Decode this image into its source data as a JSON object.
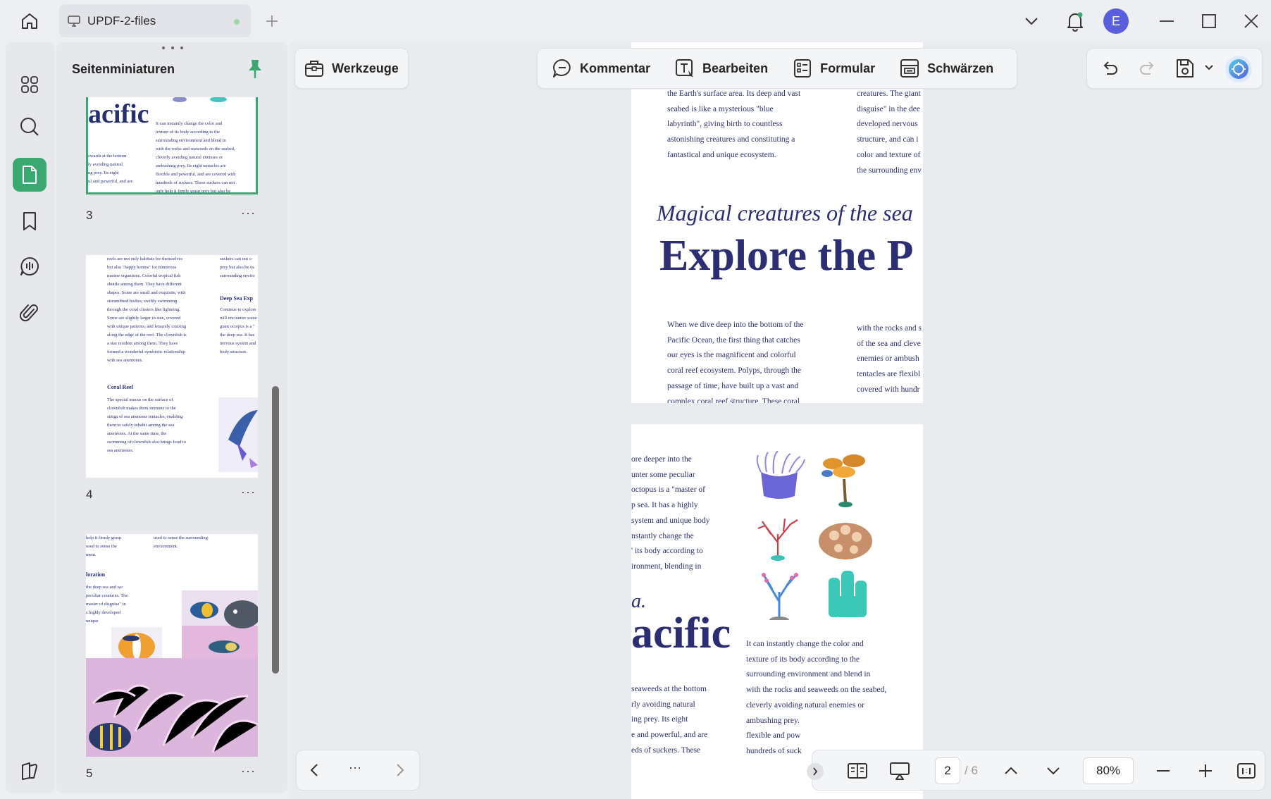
{
  "app": {
    "tab_title": "UPDF-2-files",
    "avatar_letter": "E"
  },
  "sidebar": {
    "panel_title": "Seitenminiaturen",
    "thumbnails": [
      {
        "number": "3",
        "more": "···"
      },
      {
        "number": "4",
        "more": "···"
      },
      {
        "number": "5",
        "more": "···"
      }
    ],
    "thumb3": {
      "heading": "acific",
      "col1": [
        "ewards at the bottom",
        "ly avoiding natural",
        "ng prey. Its eight",
        "ul and powerful, and are"
      ],
      "col2": [
        "It can instantly change the color and",
        "texture of its body according to the",
        "surrounding environment and blend in",
        "with the rocks and seaweeds on the seabed,",
        "cleverly avoiding natural enemies or",
        "ambushing prey. Its eight tentacles are",
        "flexible and powerful, and are covered with",
        "hundreds of suckers. These suckers can not",
        "only help it firmly grasp prey but also be"
      ]
    },
    "thumb4": {
      "col1": [
        "reefs are not only habitats for themselves",
        "but also \"happy homes\" for numerous",
        "marine organisms. Colorful tropical fish",
        "shuttle among them. They have different",
        "shapes. Some are small and exquisite, with",
        "streamlined bodies, swiftly swimming",
        "through the coral clusters like lightning.",
        "Some are slightly larger in size, covered",
        "with unique patterns, and leisurely cruising",
        "along the edge of the reef. The clownfish is",
        "a star resident among them. They have",
        "formed a wonderful symbiotic relationship",
        "with sea anemones."
      ],
      "coral_heading": "Coral Reef",
      "col1b": [
        "The special mucus on the surface of",
        "clownfish makes them immune to the",
        "stings of sea anemone tentacles, enabling",
        "them to safely inhabit among the sea",
        "anemones. At the same time, the",
        "swimming of clownfish also brings food to",
        "sea anemones."
      ],
      "col2": [
        "suckers can not o",
        "prey but also be us",
        "surrounding enviro"
      ],
      "deep_heading": "Deep Sea Exp",
      "col2b": [
        "Continue to explore",
        "will encounter some",
        "giant octopus is a \"",
        "the deep sea. It has",
        "nervous system and",
        "body structure."
      ]
    },
    "thumb5": {
      "col1": [
        "help it firmly grasp",
        "used to sense the",
        "ment."
      ],
      "col1b": [
        "used to sense the surrounding",
        "environment."
      ],
      "heading": "loration",
      "col2": [
        "the deep sea and we",
        "peculiar creatures. The",
        "master of disguise\" in",
        "s highly developed",
        "unique"
      ]
    }
  },
  "toolbar": {
    "werkzeuge": "Werkzeuge",
    "kommentar": "Kommentar",
    "bearbeiten": "Bearbeiten",
    "formular": "Formular",
    "schwaerzen": "Schwärzen"
  },
  "page_top": {
    "col1_top": [
      "the Earth's surface area. Its deep and vast",
      "seabed is like a mysterious \"blue",
      "labyrinth\", giving birth to countless",
      "astonishing creatures and constituting a",
      "fantastical and unique ecosystem."
    ],
    "col2_top": [
      "creatures. The giant",
      "disguise\" in the dee",
      "developed nervous",
      "structure, and can i",
      "color and texture of",
      "the surrounding env"
    ],
    "subtitle": "Magical creatures of the sea",
    "title": "Explore the P",
    "col1_bottom": [
      "When we dive deep into the bottom of the",
      "Pacific Ocean, the first thing that catches",
      "our eyes is the magnificent and colorful",
      "coral reef ecosystem. Polyps, through the",
      "passage of time, have built up a vast and",
      "complex coral reef structure. These coral"
    ],
    "col2_bottom": [
      "with the rocks and s",
      "of the sea and cleve",
      "enemies or ambush",
      "tentacles are flexibl",
      "covered with hundr"
    ]
  },
  "page_bottom": {
    "col_left": [
      "ore deeper into the",
      "unter some peculiar",
      "octopus is a \"master of",
      "p sea. It has a highly",
      "system and unique body",
      "nstantly change the",
      "' its body according to",
      "ironment, blending in"
    ],
    "partial_letter": "a.",
    "heading": "acific",
    "col_left2": [
      "seaweeds at the bottom",
      "rly avoiding natural",
      "ing prey. Its eight",
      "e and powerful, and are",
      "eds of suckers. These"
    ],
    "col_right": [
      "It can instantly change the color and",
      "texture of its body according to the",
      "surrounding environment and blend in",
      "with the rocks and seaweeds on the seabed,",
      "cleverly avoiding natural enemies or",
      "ambushing prey.",
      "flexible and pow",
      "hundreds of suck"
    ]
  },
  "bottom_nav": {
    "more": "···"
  },
  "bottom_bar": {
    "current_page": "2",
    "total_pages": "/ 6",
    "zoom": "80%"
  },
  "colors": {
    "accent": "#3aa870",
    "text_navy": "#2c2e74",
    "avatar": "#5a5fe0"
  }
}
